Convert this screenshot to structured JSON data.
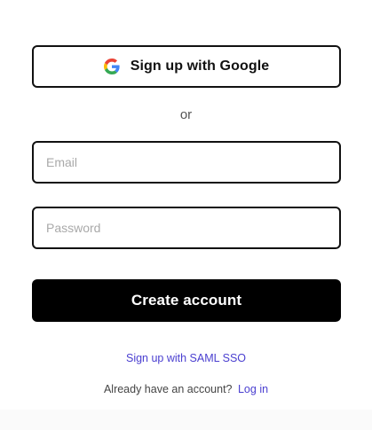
{
  "signup": {
    "google_button_label": "Sign up with Google",
    "google_icon": "google-g-icon",
    "divider_text": "or",
    "email_placeholder": "Email",
    "email_value": "",
    "password_placeholder": "Password",
    "password_value": "",
    "create_account_label": "Create account",
    "saml_link_label": "Sign up with SAML SSO",
    "have_account_text": "Already have an account?",
    "login_link_label": "Log in"
  },
  "colors": {
    "primary_button_bg": "#000000",
    "border": "#111111",
    "link": "#4a3fd0",
    "google_blue": "#4285F4",
    "google_red": "#EA4335",
    "google_yellow": "#FBBC05",
    "google_green": "#34A853"
  }
}
